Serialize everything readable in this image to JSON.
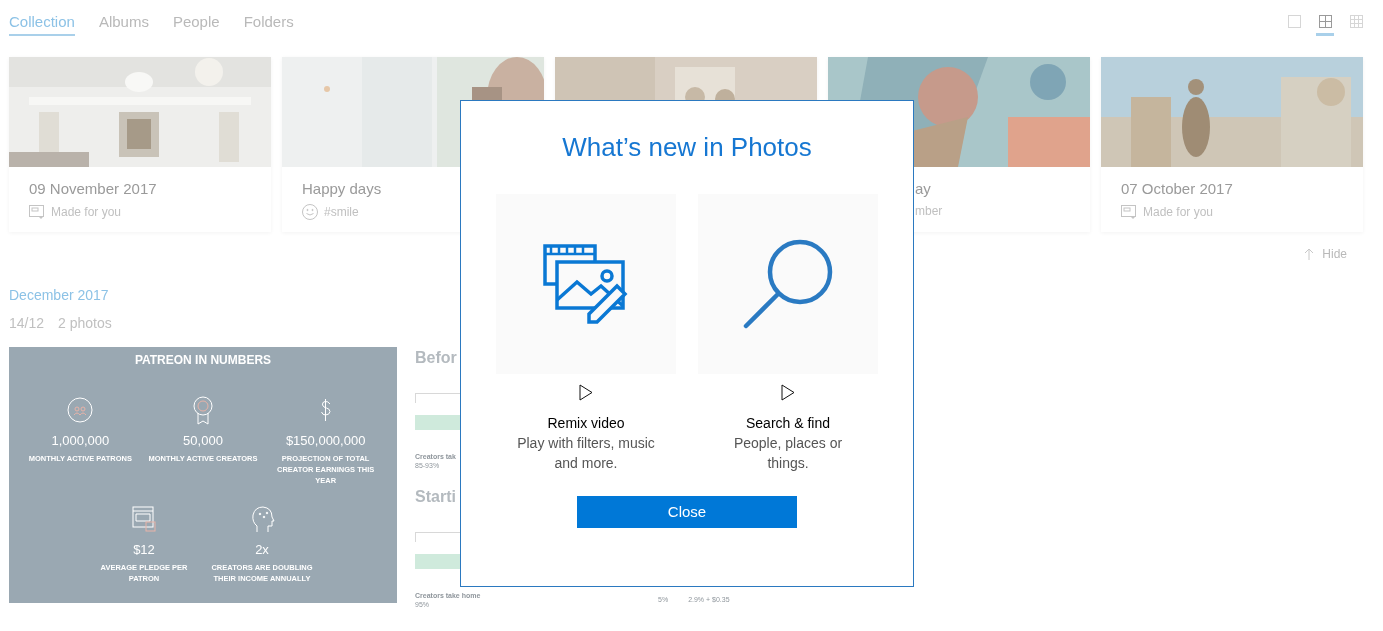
{
  "tabs": [
    {
      "label": "Collection",
      "selected": true
    },
    {
      "label": "Albums",
      "selected": false
    },
    {
      "label": "People",
      "selected": false
    },
    {
      "label": "Folders",
      "selected": false
    }
  ],
  "view_modes": [
    {
      "kind": "single",
      "selected": false
    },
    {
      "kind": "medium",
      "selected": true
    },
    {
      "kind": "small",
      "selected": false
    }
  ],
  "memories": [
    {
      "kind": "full",
      "title": "09 November 2017",
      "subtitle": "Made for you"
    },
    {
      "kind": "full",
      "title": "Happy days",
      "subtitle": "#smile"
    },
    {
      "kind": "hidden"
    },
    {
      "kind": "covered",
      "title": "ay",
      "subtitle": "mber"
    },
    {
      "kind": "full",
      "title": "07 October 2017",
      "subtitle": "Made for you"
    }
  ],
  "hide_label": "Hide",
  "month": "December 2017",
  "day": {
    "date": "14/12",
    "count": "2 photos"
  },
  "infographic": {
    "title": "PATREON IN NUMBERS",
    "stats": [
      {
        "value": "1,000,000",
        "label": "MONTHLY ACTIVE PATRONS"
      },
      {
        "value": "50,000",
        "label": "MONTHLY ACTIVE CREATORS"
      },
      {
        "value": "$150,000,000",
        "label": "PROJECTION OF TOTAL CREATOR EARNINGS THIS YEAR"
      },
      {
        "value": "$12",
        "label": "AVERAGE PLEDGE PER PATRON"
      },
      {
        "value": "2x",
        "label": "CREATORS ARE DOUBLING THEIR INCOME ANNUALLY"
      }
    ]
  },
  "comparison": {
    "sections": [
      {
        "heading": "Befor",
        "caption": "Creators tak",
        "figure": "85-93%"
      },
      {
        "heading": "Starti",
        "caption": "Creators take home",
        "figure": "95%"
      }
    ],
    "fees": [
      "5%",
      "2.9% + $0.35"
    ]
  },
  "dialog": {
    "title": "What’s new in Photos",
    "features": [
      {
        "title": "Remix video",
        "description": "Play with filters, music and more."
      },
      {
        "title": "Search & find",
        "description": "People, places or things."
      }
    ],
    "button": "Close"
  }
}
